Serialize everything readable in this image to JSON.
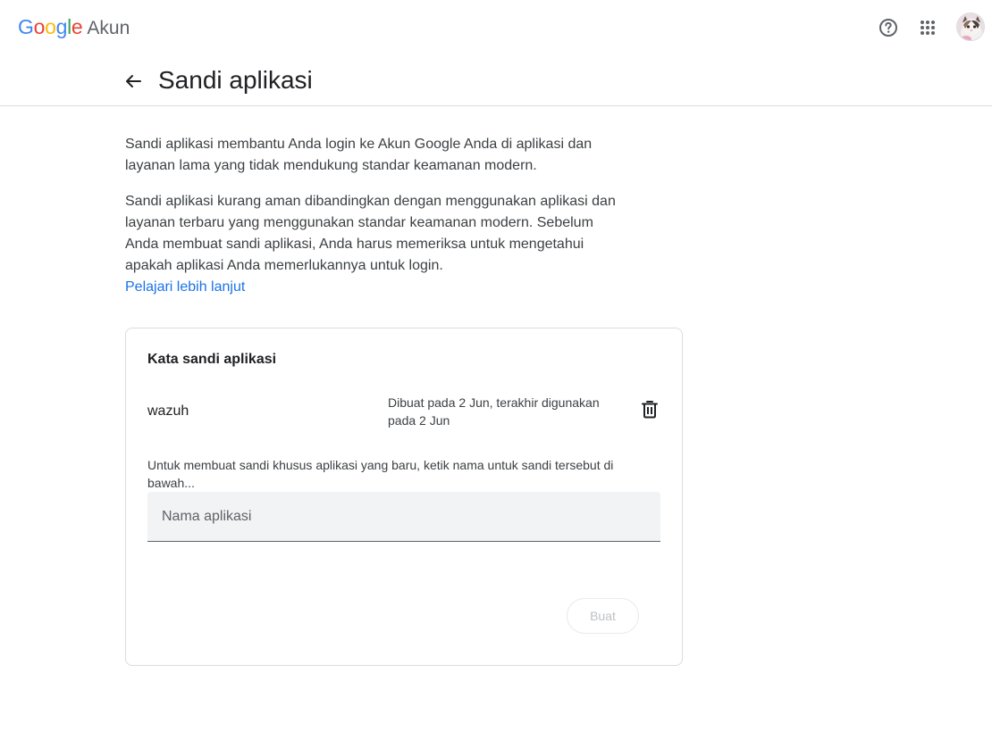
{
  "header": {
    "logo_text": "Google",
    "product_name": "Akun",
    "icons": {
      "help": "help-circle-icon",
      "apps": "apps-grid-icon",
      "avatar": "account-avatar"
    }
  },
  "page": {
    "title": "Sandi aplikasi",
    "back_icon": "arrow-back-icon"
  },
  "description": {
    "paragraph_1": "Sandi aplikasi membantu Anda login ke Akun Google Anda di aplikasi dan layanan lama yang tidak mendukung standar keamanan modern.",
    "paragraph_2": "Sandi aplikasi kurang aman dibandingkan dengan menggunakan aplikasi dan layanan terbaru yang menggunakan standar keamanan modern. Sebelum Anda membuat sandi aplikasi, Anda harus memeriksa untuk mengetahui apakah aplikasi Anda memerlukannya untuk login.",
    "learn_more": "Pelajari lebih lanjut"
  },
  "card": {
    "title": "Kata sandi aplikasi",
    "passwords": [
      {
        "name": "wazuh",
        "meta": "Dibuat pada 2 Jun, terakhir digunakan pada 2 Jun"
      }
    ],
    "hint": "Untuk membuat sandi khusus aplikasi yang baru, ketik nama untuk sandi tersebut di bawah...",
    "input": {
      "placeholder": "Nama aplikasi",
      "value": ""
    },
    "create_label": "Buat"
  },
  "colors": {
    "accent": "#1a73e8",
    "border": "#dadce0",
    "field_bg": "#f1f3f4"
  }
}
